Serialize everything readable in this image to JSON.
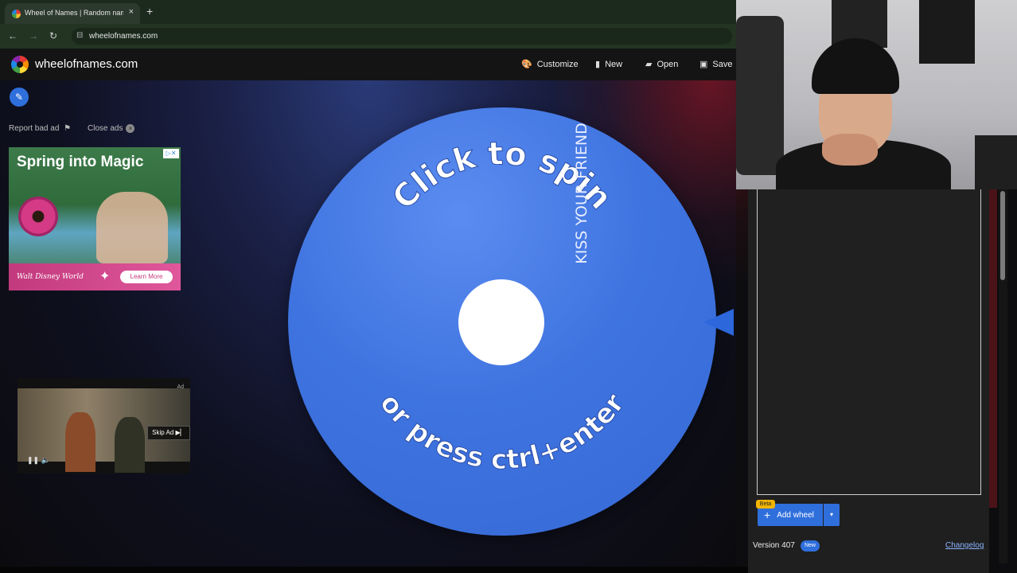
{
  "browser": {
    "tab_title": "Wheel of Names | Random nam",
    "tab_close": "×",
    "new_tab": "+",
    "url": "wheelofnames.com",
    "back": "←",
    "forward": "→",
    "reload": "↻",
    "tune": "⊟"
  },
  "header": {
    "site_name": "wheelofnames.com",
    "buttons": [
      {
        "label": "Customize",
        "icon": "palette-icon",
        "glyph": "🎨"
      },
      {
        "label": "New",
        "icon": "file-icon",
        "glyph": "▮"
      },
      {
        "label": "Open",
        "icon": "folder-icon",
        "glyph": "▰"
      },
      {
        "label": "Save",
        "icon": "save-icon",
        "glyph": "▣"
      }
    ]
  },
  "sidebar": {
    "edit_glyph": "✎",
    "report_bad_ad": "Report bad ad",
    "report_flag": "⚑",
    "close_ads": "Close ads",
    "close_glyph": "×"
  },
  "ad": {
    "headline": "Spring into Magic",
    "brand": "Walt Disney World",
    "cta": "Learn More",
    "choice": "▷✕"
  },
  "video_ad": {
    "ad_label": "Ad",
    "skip": "Skip Ad ▶▏",
    "controls": "❚❚  🔈"
  },
  "wheel": {
    "color": "#3f74e0",
    "top_text": "Click to spin",
    "bottom_text": "or press ctrl+enter",
    "entry": "KISS YOUR FRIEND"
  },
  "right_panel": {
    "beta": "Beta",
    "add_wheel": "Add wheel",
    "add_wheel_plus": "+",
    "dropdown": "▾",
    "version": "Version 407",
    "new_badge": "New",
    "changelog": "Changelog"
  },
  "colors": {
    "accent": "#2f6fdc",
    "wheel": "#3f74e0",
    "header_bg": "#141414"
  }
}
